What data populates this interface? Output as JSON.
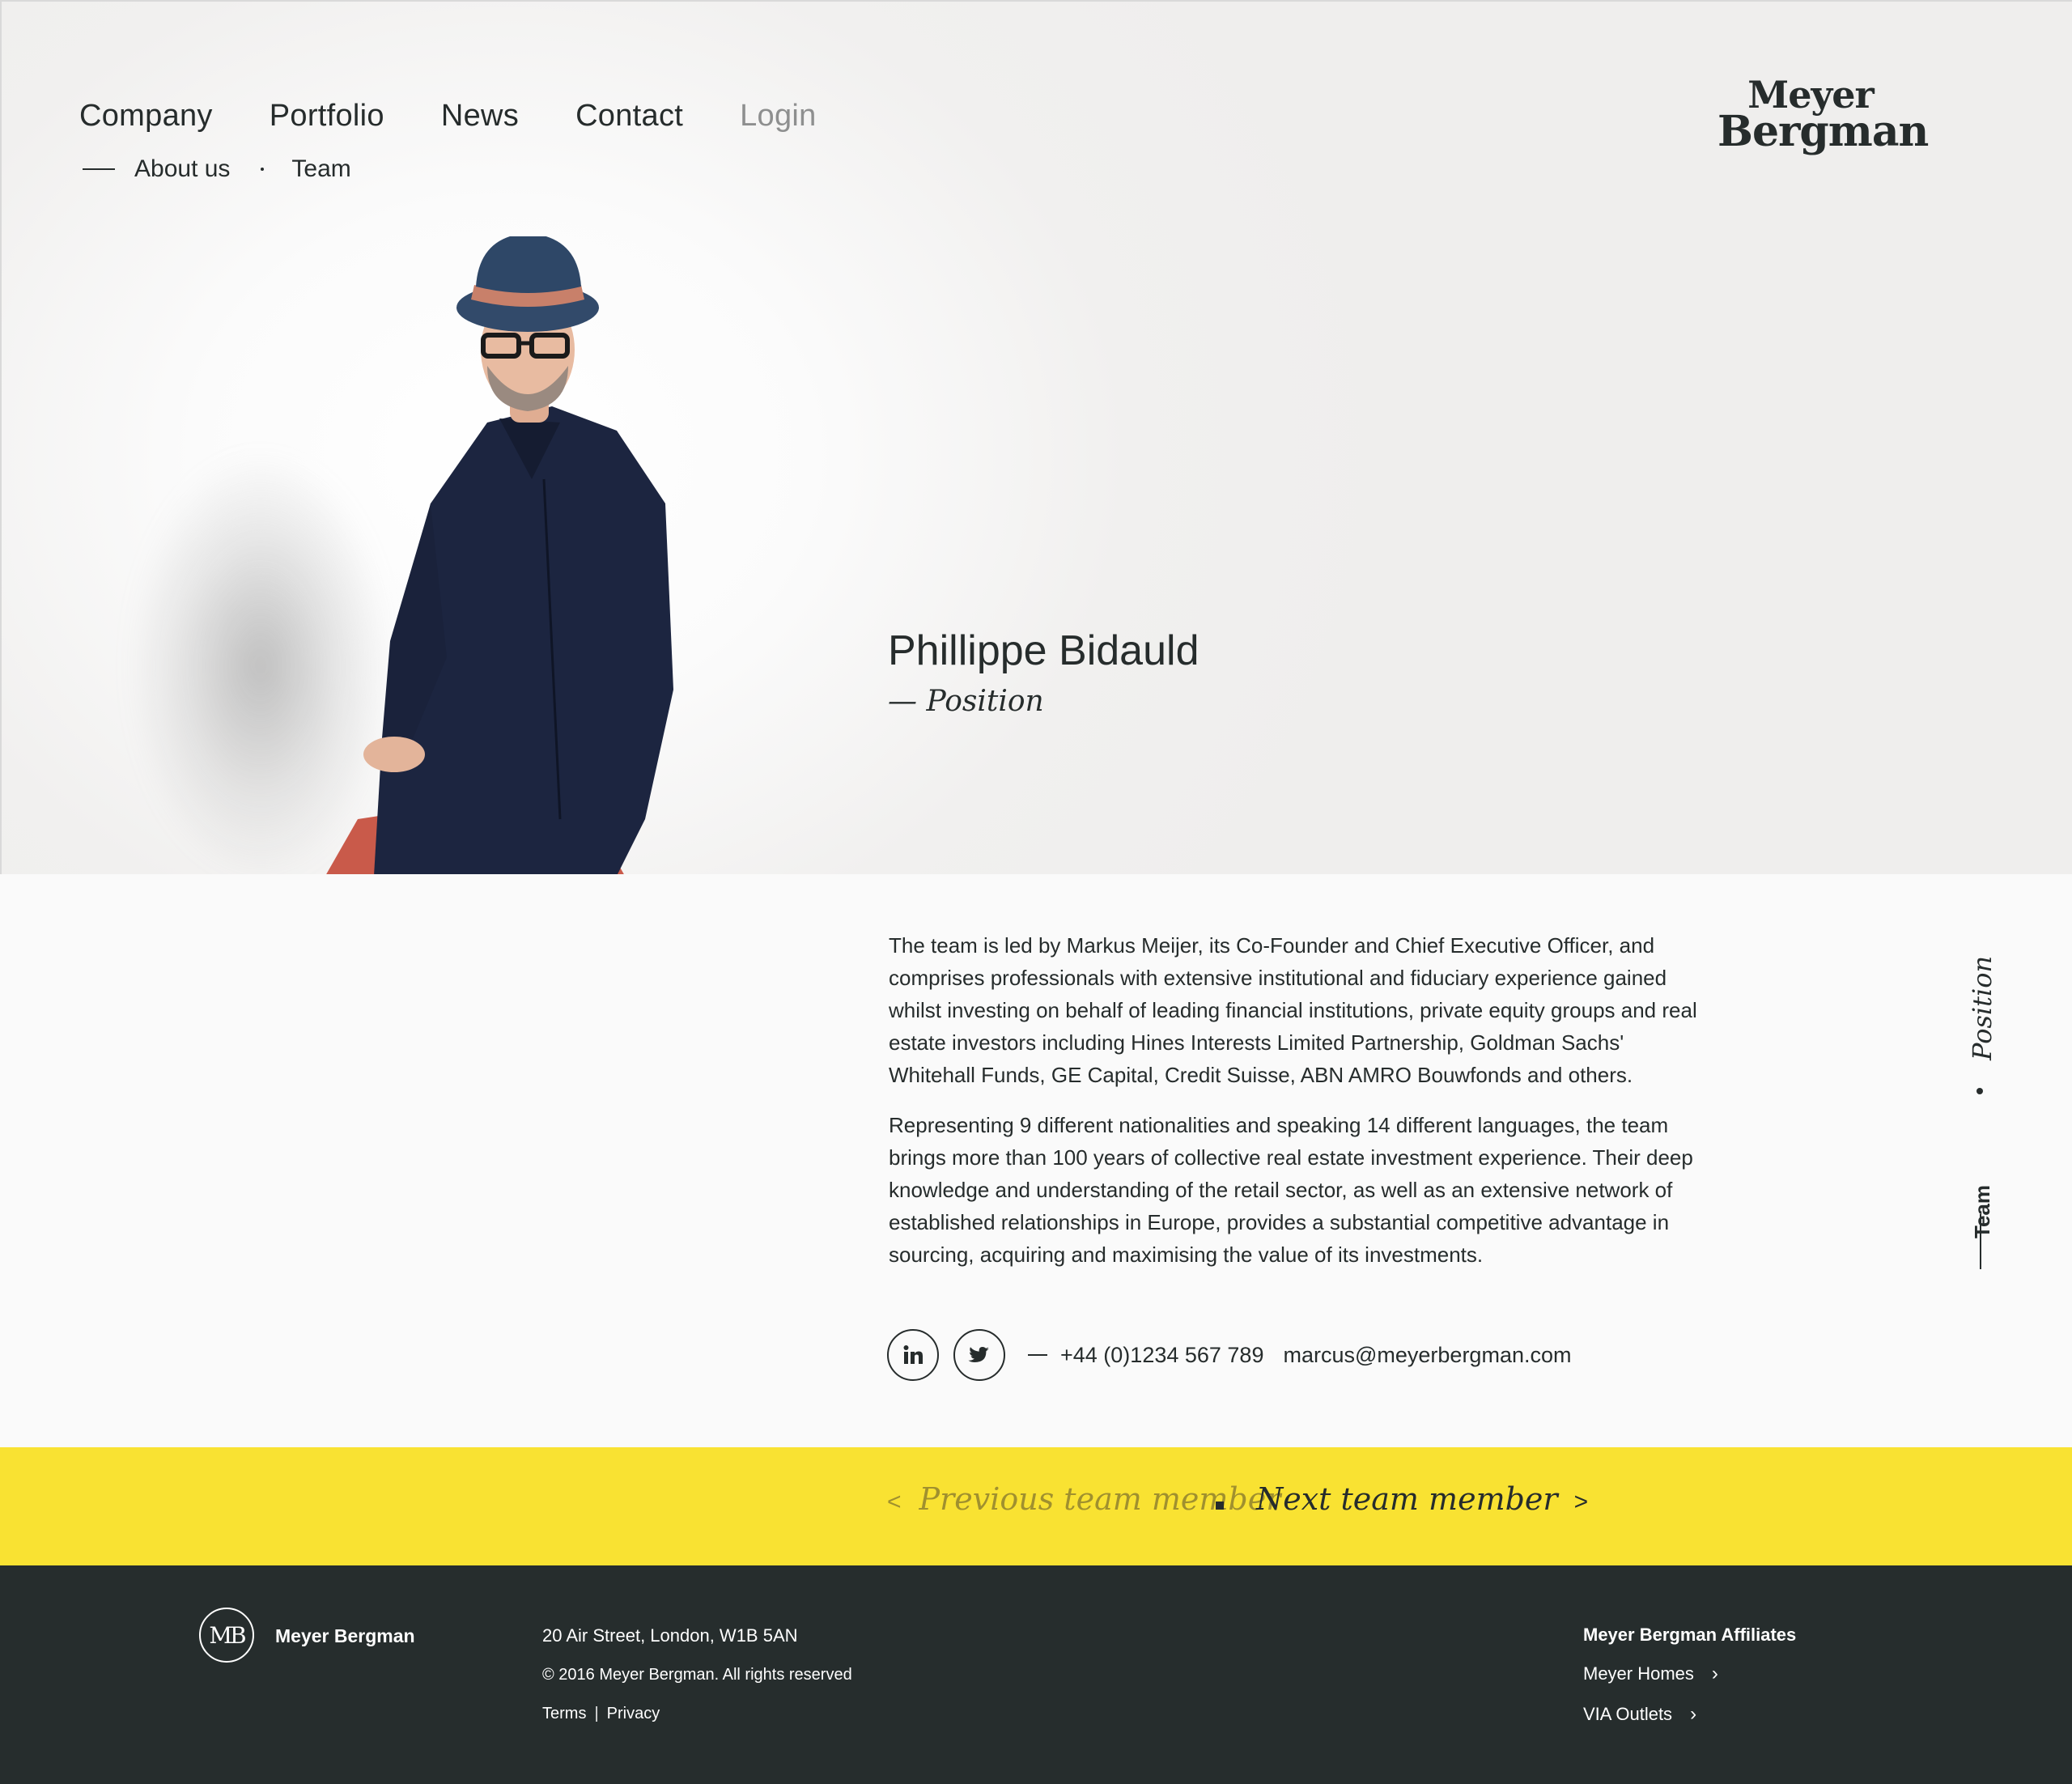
{
  "nav": {
    "items": [
      {
        "label": "Company"
      },
      {
        "label": "Portfolio"
      },
      {
        "label": "News"
      },
      {
        "label": "Contact"
      },
      {
        "label": "Login"
      }
    ],
    "subnav": {
      "about": "About us",
      "team": "Team"
    }
  },
  "logo": {
    "line1": "Meyer",
    "line2": "Bergman"
  },
  "profile": {
    "name": "Phillippe Bidauld",
    "position": "— Position",
    "bio": [
      "The team is led by Markus Meijer, its Co-Founder and Chief Executive Officer, and comprises professionals with extensive institutional and fiduciary experience gained whilst investing on behalf of leading financial institutions, private equity groups and real estate investors including Hines Interests Limited Partnership, Goldman Sachs' Whitehall Funds, GE Capital, Credit Suisse, ABN AMRO Bouwfonds and others.",
      "Representing 9 different nationalities and speaking 14 different languages, the team brings more than 100 years of collective real estate investment experience. Their deep knowledge and understanding of the retail sector, as well as an extensive network of established relationships in Europe, provides a substantial competitive advantage in sourcing, acquiring and maximising the value of its investments."
    ],
    "phone": "+44 (0)1234 567 789",
    "email": "marcus@meyerbergman.com"
  },
  "side": {
    "position": "Position",
    "team": "Team"
  },
  "pager": {
    "prev": "Previous team member",
    "next": "Next team member",
    "prev_chev": "<",
    "next_chev": ">"
  },
  "footer": {
    "mark": "MB",
    "brand": "Meyer Bergman",
    "address": "20 Air Street, London, W1B 5AN",
    "copyright": "© 2016 Meyer Bergman. All rights reserved",
    "terms": "Terms",
    "sep": "|",
    "privacy": "Privacy",
    "affiliates_title": "Meyer Bergman Affiliates",
    "affiliates": [
      "Meyer Homes",
      "VIA Outlets"
    ]
  },
  "colors": {
    "accent_yellow": "#f9e232",
    "footer_bg": "#262d2d",
    "text_dark": "#262c2c"
  }
}
